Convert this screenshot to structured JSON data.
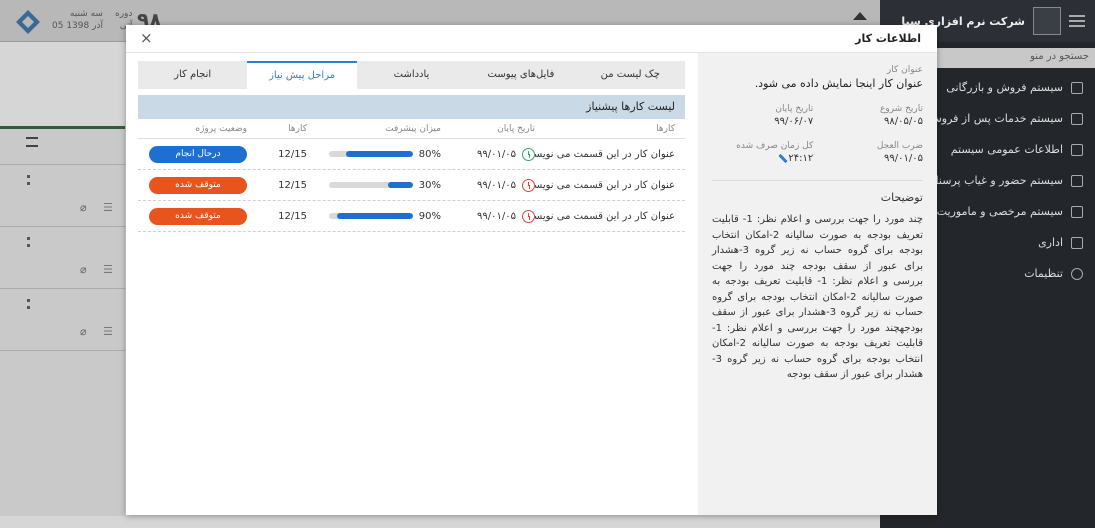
{
  "app": {
    "date_label": "سه شنبه",
    "date_value": "05 آذر 1398",
    "period_label": "دوره",
    "period_sub": "آتی",
    "big_number": "۹۸",
    "company": "شرکت نرم افزاری سپا",
    "search_placeholder": "جستجو در منو",
    "menu": [
      {
        "label": "سیستم فروش و بازرگانی",
        "icon": "doc-icon"
      },
      {
        "label": "سیستم خدمات پس از فروش",
        "icon": "chat-icon"
      },
      {
        "label": "اطلاعات عمومی سیستم",
        "icon": "chat-icon"
      },
      {
        "label": "سیستم حضور و غیاب پرسنل",
        "icon": "chat-icon"
      },
      {
        "label": "سیستم مرخصی و ماموریت",
        "icon": "chat-icon"
      },
      {
        "label": "اداری",
        "icon": "mail-icon"
      },
      {
        "label": "تنظیمات",
        "icon": "gear-icon"
      }
    ]
  },
  "modal": {
    "title": "اطلاعات کار",
    "close": "×",
    "info": {
      "title_label": "عنوان کار",
      "title_value": "عنوان کار اینجا نمایش داده می شود.",
      "start_label": "تاریخ شروع",
      "start_value": "۹۸/۰۵/۰۵",
      "end_label": "تاریخ پایان",
      "end_value": "۹۹/۰۶/۰۷",
      "deadline_label": "ضرب العجل",
      "deadline_value": "۹۹/۰۱/۰۵",
      "spent_label": "کل زمان صرف شده",
      "spent_value": "۲۴:۱۲",
      "desc_label": "توضیحات",
      "desc_text": "چند مورد را جهت بررسی و اعلام نظر: 1- قابلیت تعریف بودجه به صورت سالیانه 2-امکان انتخاب بودجه برای گروه حساب نه زیر گروه 3-هشدار برای عبور از سقف بودجه چند مورد را جهت بررسی و اعلام نظر: 1- قابلیت تعریف بودجه به صورت سالیانه 2-امکان انتخاب بودجه برای گروه حساب نه زیر گروه 3-هشدار برای عبور از سقف بودجهچند مورد را جهت بررسی و اعلام نظر: 1- قابلیت تعریف بودجه به صورت سالیانه 2-امکان انتخاب بودجه برای گروه حساب نه زیر گروه 3-هشدار برای عبور از سقف بودجه"
    },
    "tabs": [
      "چک لیست من",
      "فایل‌های پیوست",
      "یادداشت",
      "مراحل پیش نیاز",
      "انجام کار"
    ],
    "active_tab": 3,
    "list": {
      "title": "لیست کارها پیشنیاز",
      "columns": [
        "کارها",
        "تاریخ پایان",
        "میزان پیشرفت",
        "کارها",
        "وضعیت پروژه"
      ],
      "rows": [
        {
          "title": "عنوان کار در این قسمت می نویسیم",
          "end": "۹۹/۰۱/۰۵",
          "clock": "ok",
          "progress": 80,
          "progress_label": "80%",
          "tasks": "12/15",
          "status": "درحال انجام",
          "status_color": "#1e6fd0"
        },
        {
          "title": "عنوان کار در این قسمت می نویسیم",
          "end": "۹۹/۰۱/۰۵",
          "clock": "late",
          "progress": 30,
          "progress_label": "30%",
          "tasks": "12/15",
          "status": "متوقف شده",
          "status_color": "#e8541e"
        },
        {
          "title": "عنوان کار در این قسمت می نویسیم",
          "end": "۹۹/۰۱/۰۵",
          "clock": "late",
          "progress": 90,
          "progress_label": "90%",
          "tasks": "12/15",
          "status": "متوقف شده",
          "status_color": "#e8541e"
        }
      ]
    }
  }
}
